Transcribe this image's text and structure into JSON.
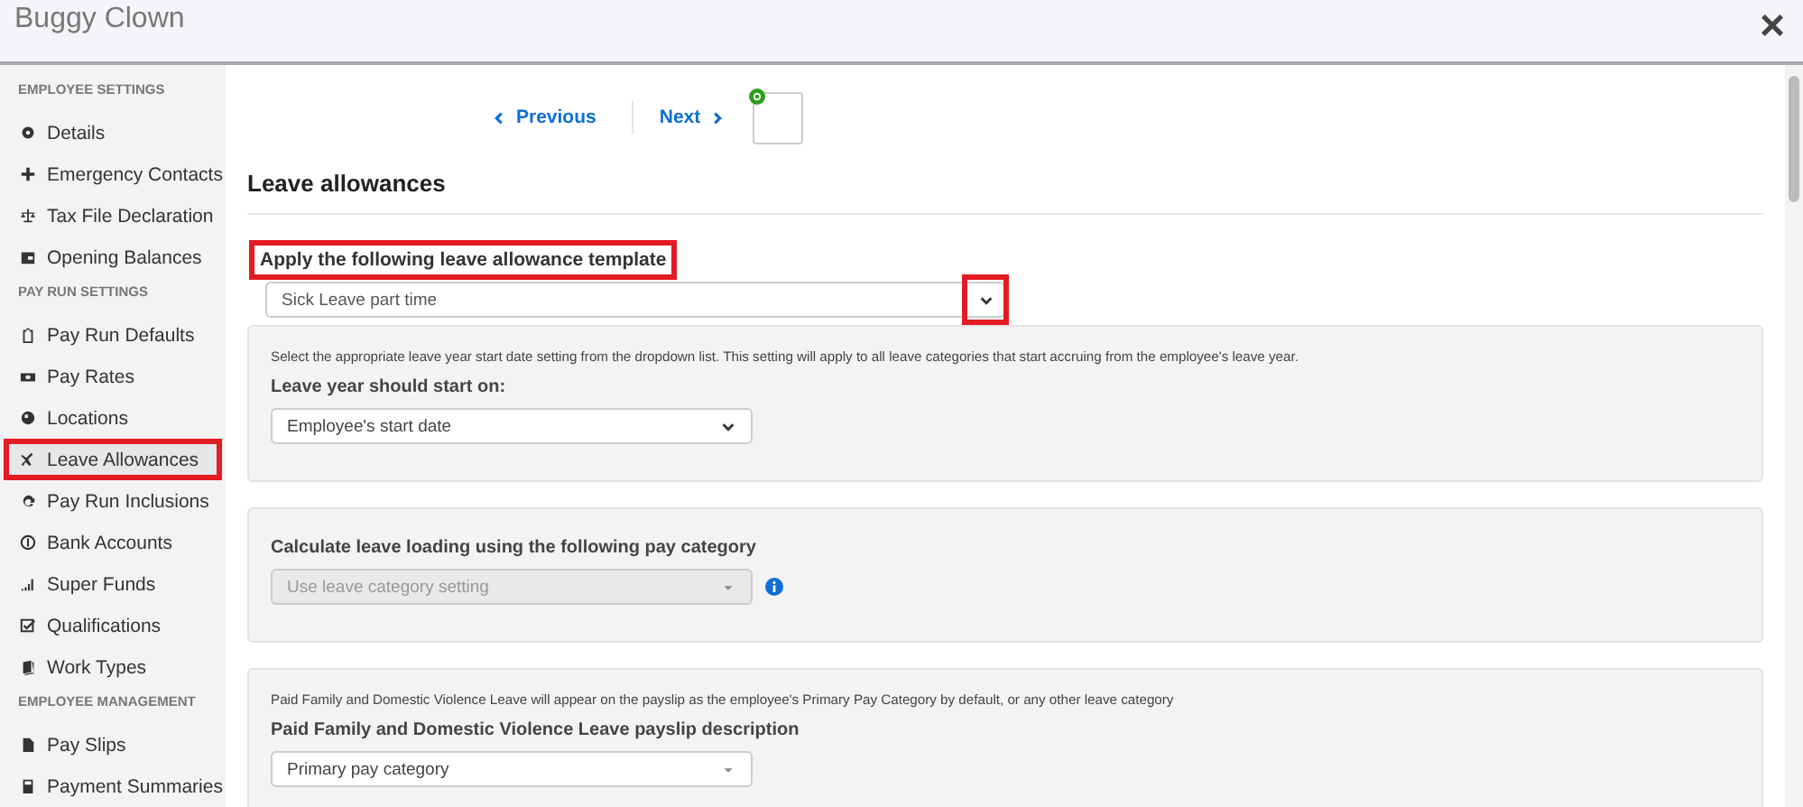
{
  "window": {
    "title": "Buggy Clown",
    "close": "×"
  },
  "sidebar": {
    "sections": [
      {
        "title": "EMPLOYEE SETTINGS",
        "items": [
          {
            "label": "Details",
            "selected": false,
            "highlighted": false
          },
          {
            "label": "Emergency Contacts",
            "selected": false,
            "highlighted": false
          },
          {
            "label": "Tax File Declaration",
            "selected": false,
            "highlighted": false
          },
          {
            "label": "Opening Balances",
            "selected": false,
            "highlighted": false
          }
        ]
      },
      {
        "title": "PAY RUN SETTINGS",
        "items": [
          {
            "label": "Pay Run Defaults",
            "selected": false,
            "highlighted": false
          },
          {
            "label": "Pay Rates",
            "selected": false,
            "highlighted": false
          },
          {
            "label": "Locations",
            "selected": false,
            "highlighted": false
          },
          {
            "label": "Leave Allowances",
            "selected": true,
            "highlighted": true
          },
          {
            "label": "Pay Run Inclusions",
            "selected": false,
            "highlighted": false
          },
          {
            "label": "Bank Accounts",
            "selected": false,
            "highlighted": false
          },
          {
            "label": "Super Funds",
            "selected": false,
            "highlighted": false
          },
          {
            "label": "Qualifications",
            "selected": false,
            "highlighted": false
          },
          {
            "label": "Work Types",
            "selected": false,
            "highlighted": false
          }
        ]
      },
      {
        "title": "EMPLOYEE MANAGEMENT",
        "items": [
          {
            "label": "Pay Slips",
            "selected": false,
            "highlighted": false
          },
          {
            "label": "Payment Summaries",
            "selected": false,
            "highlighted": false
          }
        ]
      }
    ]
  },
  "pager": {
    "previous": "Previous",
    "next": "Next"
  },
  "heading": "Leave allowances",
  "template": {
    "label": "Apply the following leave allowance template",
    "label_highlighted": true,
    "value": "Sick Leave part time",
    "arrow_highlighted": true
  },
  "panels": [
    {
      "note": "Select the appropriate leave year start date setting from the dropdown list. This setting will apply to all leave categories that start accruing from the employee's leave year.",
      "label": "Leave year should start on:",
      "value": "Employee's start date",
      "disabled": false,
      "info": false
    },
    {
      "label": "Calculate leave loading using the following pay category",
      "value": "Use leave category setting",
      "disabled": true,
      "info": true
    },
    {
      "note": "Paid Family and Domestic Violence Leave will appear on the payslip as the employee's Primary Pay Category by default, or any other leave category",
      "label": "Paid Family and Domestic Violence Leave payslip description",
      "value": "Primary pay category",
      "disabled": false,
      "info": false
    }
  ]
}
